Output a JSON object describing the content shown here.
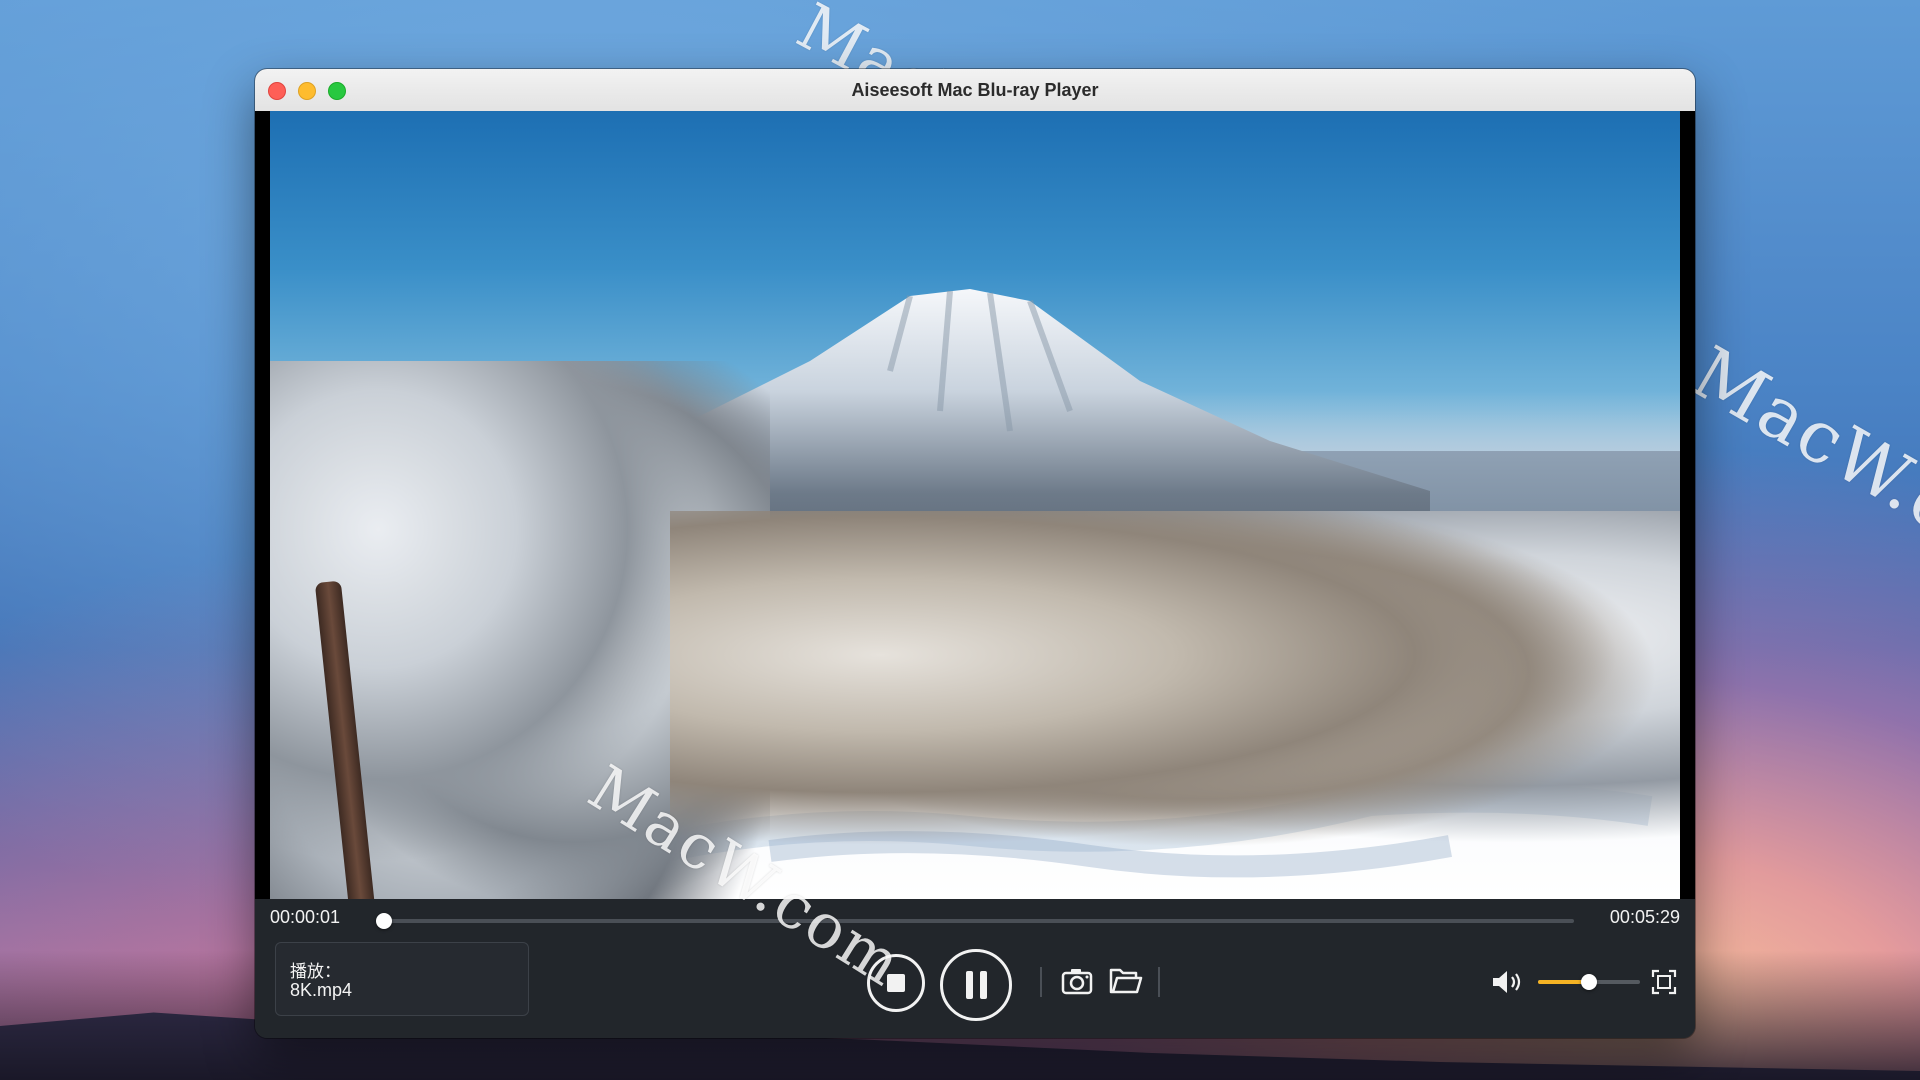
{
  "window": {
    "title": "Aiseesoft Mac Blu-ray Player"
  },
  "watermark": {
    "text": "MacW.com"
  },
  "player": {
    "current_time": "00:00:01",
    "total_time": "00:05:29",
    "progress_fraction": 0.003,
    "status_label": "播放：",
    "file_name": "8K.mp4",
    "volume_fraction": 0.5,
    "accent_color": "#f5b324"
  },
  "controls": {
    "stop": "stop-icon",
    "pause": "pause-icon",
    "snapshot": "camera-icon",
    "open": "folder-icon",
    "volume": "speaker-icon",
    "fullscreen": "fullscreen-icon"
  }
}
